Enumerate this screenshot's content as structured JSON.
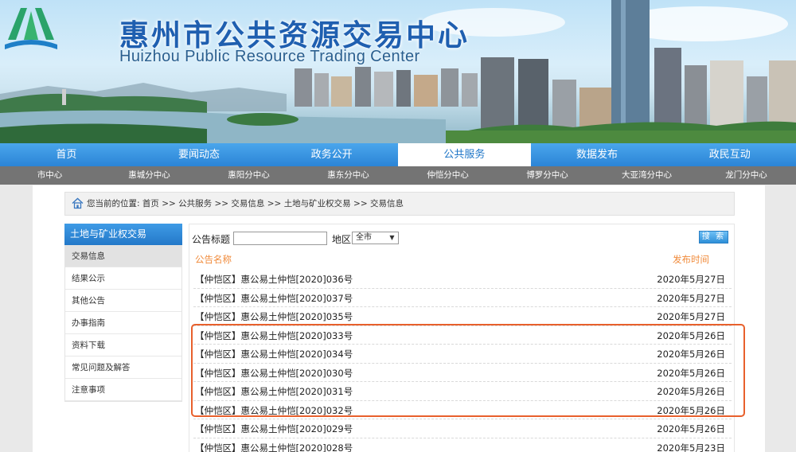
{
  "header": {
    "title_cn": "惠州市公共资源交易中心",
    "title_en": "Huizhou Public Resource Trading Center"
  },
  "main_nav": [
    {
      "label": "首页",
      "active": false
    },
    {
      "label": "要闻动态",
      "active": false
    },
    {
      "label": "政务公开",
      "active": false
    },
    {
      "label": "公共服务",
      "active": true
    },
    {
      "label": "数据发布",
      "active": false
    },
    {
      "label": "政民互动",
      "active": false
    }
  ],
  "sub_nav": [
    "市中心",
    "惠城分中心",
    "惠阳分中心",
    "惠东分中心",
    "仲恺分中心",
    "博罗分中心",
    "大亚湾分中心",
    "龙门分中心"
  ],
  "breadcrumb": {
    "text": "您当前的位置: 首页 >> 公共服务 >> 交易信息 >> 土地与矿业权交易 >> 交易信息"
  },
  "sidebar": {
    "heading": "土地与矿业权交易",
    "items": [
      {
        "label": "交易信息",
        "active": true
      },
      {
        "label": "结果公示",
        "active": false
      },
      {
        "label": "其他公告",
        "active": false
      },
      {
        "label": "办事指南",
        "active": false
      },
      {
        "label": "资料下载",
        "active": false
      },
      {
        "label": "常见问题及解答",
        "active": false
      },
      {
        "label": "注意事项",
        "active": false
      }
    ]
  },
  "search": {
    "title_label": "公告标题",
    "title_value": "",
    "region_label": "地区",
    "region_value": "全市",
    "button_label": "搜 索"
  },
  "table": {
    "columns": [
      "公告名称",
      "发布时间"
    ],
    "rows": [
      {
        "name": "【仲恺区】惠公易土仲恺[2020]036号",
        "date": "2020年5月27日"
      },
      {
        "name": "【仲恺区】惠公易土仲恺[2020]037号",
        "date": "2020年5月27日"
      },
      {
        "name": "【仲恺区】惠公易土仲恺[2020]035号",
        "date": "2020年5月27日"
      },
      {
        "name": "【仲恺区】惠公易土仲恺[2020]033号",
        "date": "2020年5月26日"
      },
      {
        "name": "【仲恺区】惠公易土仲恺[2020]034号",
        "date": "2020年5月26日"
      },
      {
        "name": "【仲恺区】惠公易土仲恺[2020]030号",
        "date": "2020年5月26日"
      },
      {
        "name": "【仲恺区】惠公易土仲恺[2020]031号",
        "date": "2020年5月26日"
      },
      {
        "name": "【仲恺区】惠公易土仲恺[2020]032号",
        "date": "2020年5月26日"
      },
      {
        "name": "【仲恺区】惠公易土仲恺[2020]029号",
        "date": "2020年5月26日"
      },
      {
        "name": "【仲恺区】惠公易土仲恺[2020]028号",
        "date": "2020年5月23日"
      }
    ]
  },
  "colors": {
    "nav_blue": "#2b84d6",
    "subnav_gray": "#747474",
    "column_header_orange": "#f08a3a",
    "highlight_orange": "#e8602c"
  }
}
